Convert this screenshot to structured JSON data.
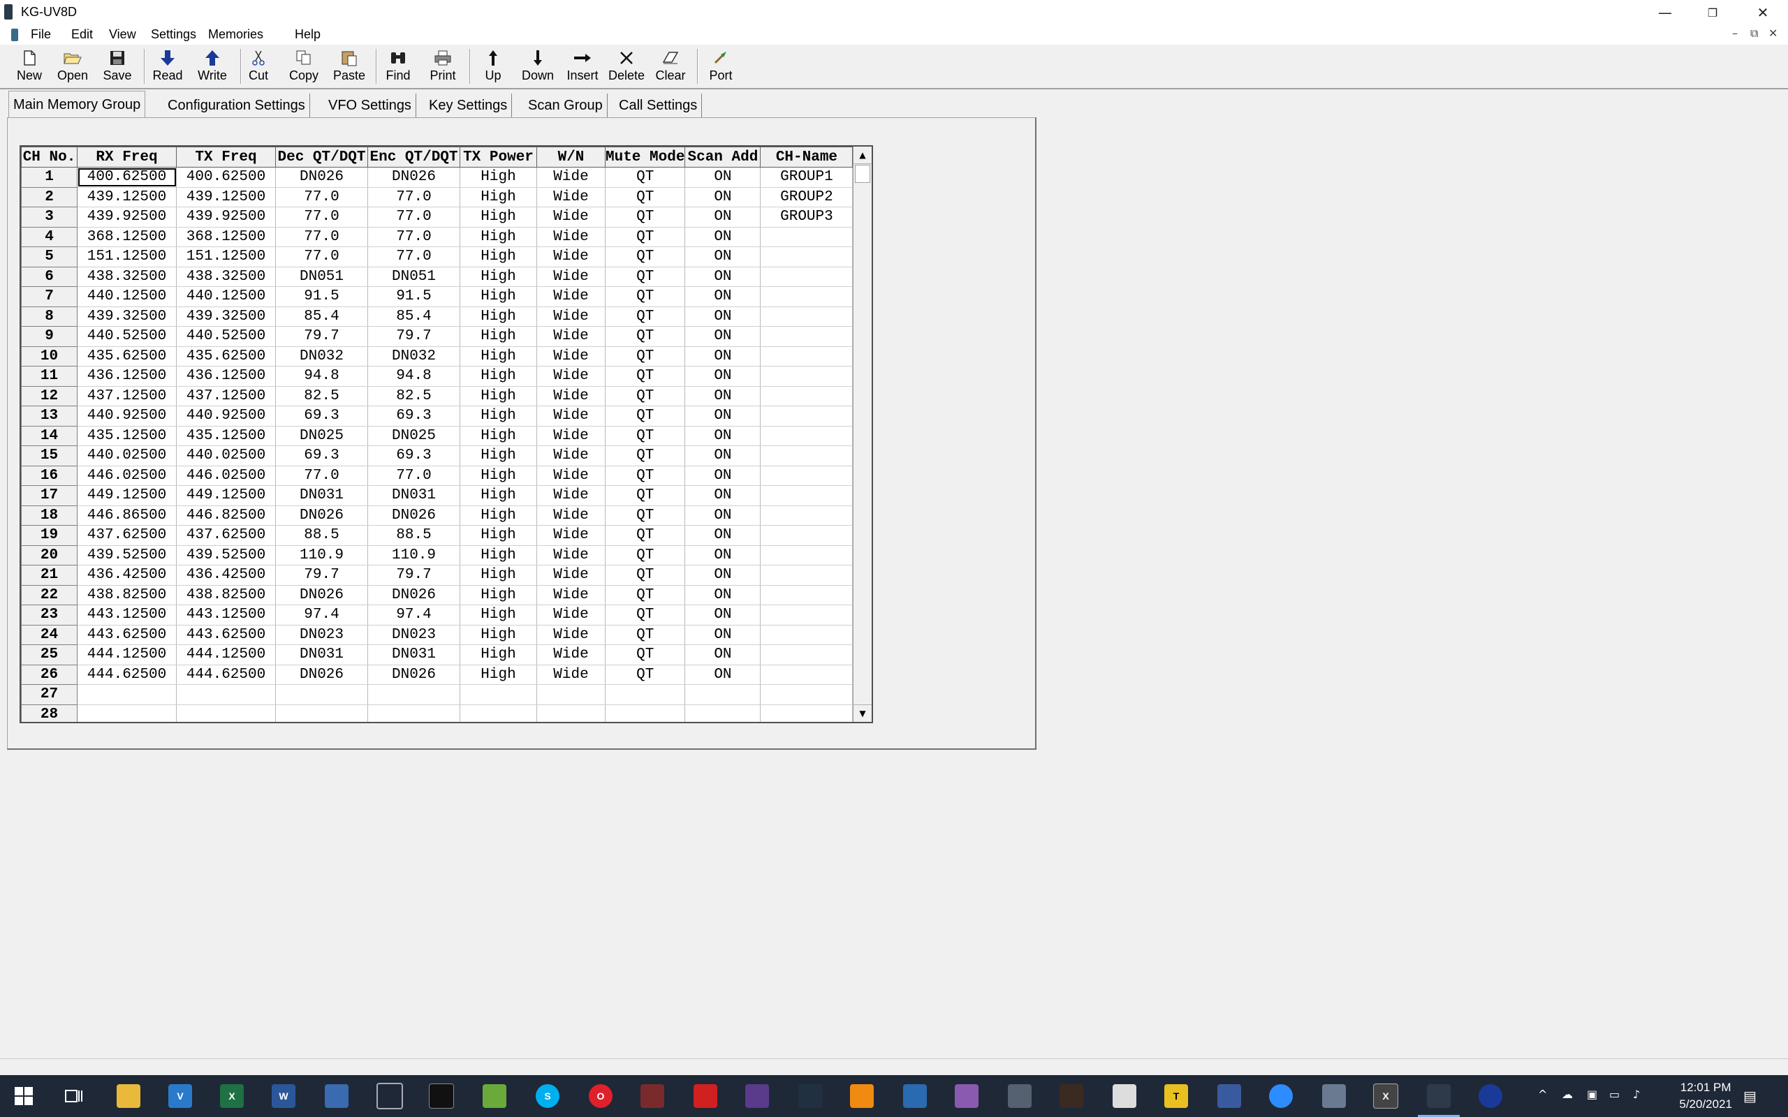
{
  "window": {
    "title": "KG-UV8D"
  },
  "menu": [
    "File",
    "Edit",
    "View",
    "Settings",
    "Memories",
    "Help"
  ],
  "toolbar": [
    {
      "label": "New",
      "icon": "new-file-icon"
    },
    {
      "label": "Open",
      "icon": "open-folder-icon"
    },
    {
      "label": "Save",
      "icon": "save-disk-icon"
    },
    {
      "label": "Read",
      "icon": "read-arrow-down-icon"
    },
    {
      "label": "Write",
      "icon": "write-arrow-up-icon"
    },
    {
      "label": "Cut",
      "icon": "scissors-icon"
    },
    {
      "label": "Copy",
      "icon": "copy-icon"
    },
    {
      "label": "Paste",
      "icon": "paste-icon"
    },
    {
      "label": "Find",
      "icon": "binoculars-icon"
    },
    {
      "label": "Print",
      "icon": "printer-icon"
    },
    {
      "label": "Up",
      "icon": "arrow-up-icon"
    },
    {
      "label": "Down",
      "icon": "arrow-down-icon"
    },
    {
      "label": "Insert",
      "icon": "arrow-right-icon"
    },
    {
      "label": "Delete",
      "icon": "x-icon"
    },
    {
      "label": "Clear",
      "icon": "eraser-icon"
    },
    {
      "label": "Port",
      "icon": "port-icon"
    }
  ],
  "tabs": [
    "Main Memory Group",
    "Configuration Settings",
    "VFO Settings",
    "Key Settings",
    "Scan Group",
    "Call Settings"
  ],
  "grid": {
    "columns": [
      "CH No.",
      "RX Freq",
      "TX Freq",
      "Dec QT/DQT",
      "Enc QT/DQT",
      "TX Power",
      "W/N",
      "Mute Mode",
      "Scan Add",
      "CH-Name"
    ],
    "rows": [
      [
        "1",
        "400.62500",
        "400.62500",
        "DN026",
        "DN026",
        "High",
        "Wide",
        "QT",
        "ON",
        "GROUP1"
      ],
      [
        "2",
        "439.12500",
        "439.12500",
        "77.0",
        "77.0",
        "High",
        "Wide",
        "QT",
        "ON",
        "GROUP2"
      ],
      [
        "3",
        "439.92500",
        "439.92500",
        "77.0",
        "77.0",
        "High",
        "Wide",
        "QT",
        "ON",
        "GROUP3"
      ],
      [
        "4",
        "368.12500",
        "368.12500",
        "77.0",
        "77.0",
        "High",
        "Wide",
        "QT",
        "ON",
        ""
      ],
      [
        "5",
        "151.12500",
        "151.12500",
        "77.0",
        "77.0",
        "High",
        "Wide",
        "QT",
        "ON",
        ""
      ],
      [
        "6",
        "438.32500",
        "438.32500",
        "DN051",
        "DN051",
        "High",
        "Wide",
        "QT",
        "ON",
        ""
      ],
      [
        "7",
        "440.12500",
        "440.12500",
        "91.5",
        "91.5",
        "High",
        "Wide",
        "QT",
        "ON",
        ""
      ],
      [
        "8",
        "439.32500",
        "439.32500",
        "85.4",
        "85.4",
        "High",
        "Wide",
        "QT",
        "ON",
        ""
      ],
      [
        "9",
        "440.52500",
        "440.52500",
        "79.7",
        "79.7",
        "High",
        "Wide",
        "QT",
        "ON",
        ""
      ],
      [
        "10",
        "435.62500",
        "435.62500",
        "DN032",
        "DN032",
        "High",
        "Wide",
        "QT",
        "ON",
        ""
      ],
      [
        "11",
        "436.12500",
        "436.12500",
        "94.8",
        "94.8",
        "High",
        "Wide",
        "QT",
        "ON",
        ""
      ],
      [
        "12",
        "437.12500",
        "437.12500",
        "82.5",
        "82.5",
        "High",
        "Wide",
        "QT",
        "ON",
        ""
      ],
      [
        "13",
        "440.92500",
        "440.92500",
        "69.3",
        "69.3",
        "High",
        "Wide",
        "QT",
        "ON",
        ""
      ],
      [
        "14",
        "435.12500",
        "435.12500",
        "DN025",
        "DN025",
        "High",
        "Wide",
        "QT",
        "ON",
        ""
      ],
      [
        "15",
        "440.02500",
        "440.02500",
        "69.3",
        "69.3",
        "High",
        "Wide",
        "QT",
        "ON",
        ""
      ],
      [
        "16",
        "446.02500",
        "446.02500",
        "77.0",
        "77.0",
        "High",
        "Wide",
        "QT",
        "ON",
        ""
      ],
      [
        "17",
        "449.12500",
        "449.12500",
        "DN031",
        "DN031",
        "High",
        "Wide",
        "QT",
        "ON",
        ""
      ],
      [
        "18",
        "446.86500",
        "446.82500",
        "DN026",
        "DN026",
        "High",
        "Wide",
        "QT",
        "ON",
        ""
      ],
      [
        "19",
        "437.62500",
        "437.62500",
        "88.5",
        "88.5",
        "High",
        "Wide",
        "QT",
        "ON",
        ""
      ],
      [
        "20",
        "439.52500",
        "439.52500",
        "110.9",
        "110.9",
        "High",
        "Wide",
        "QT",
        "ON",
        ""
      ],
      [
        "21",
        "436.42500",
        "436.42500",
        "79.7",
        "79.7",
        "High",
        "Wide",
        "QT",
        "ON",
        ""
      ],
      [
        "22",
        "438.82500",
        "438.82500",
        "DN026",
        "DN026",
        "High",
        "Wide",
        "QT",
        "ON",
        ""
      ],
      [
        "23",
        "443.12500",
        "443.12500",
        "97.4",
        "97.4",
        "High",
        "Wide",
        "QT",
        "ON",
        ""
      ],
      [
        "24",
        "443.62500",
        "443.62500",
        "DN023",
        "DN023",
        "High",
        "Wide",
        "QT",
        "ON",
        ""
      ],
      [
        "25",
        "444.12500",
        "444.12500",
        "DN031",
        "DN031",
        "High",
        "Wide",
        "QT",
        "ON",
        ""
      ],
      [
        "26",
        "444.62500",
        "444.62500",
        "DN026",
        "DN026",
        "High",
        "Wide",
        "QT",
        "ON",
        ""
      ],
      [
        "27",
        "",
        "",
        "",
        "",
        "",
        "",
        "",
        "",
        ""
      ],
      [
        "28",
        "",
        "",
        "",
        "",
        "",
        "",
        "",
        "",
        ""
      ]
    ]
  },
  "taskbar": {
    "time": "12:01 PM",
    "date": "5/20/2021"
  },
  "colors": {
    "accent": "#0078d7",
    "taskbar": "#1f2836"
  }
}
